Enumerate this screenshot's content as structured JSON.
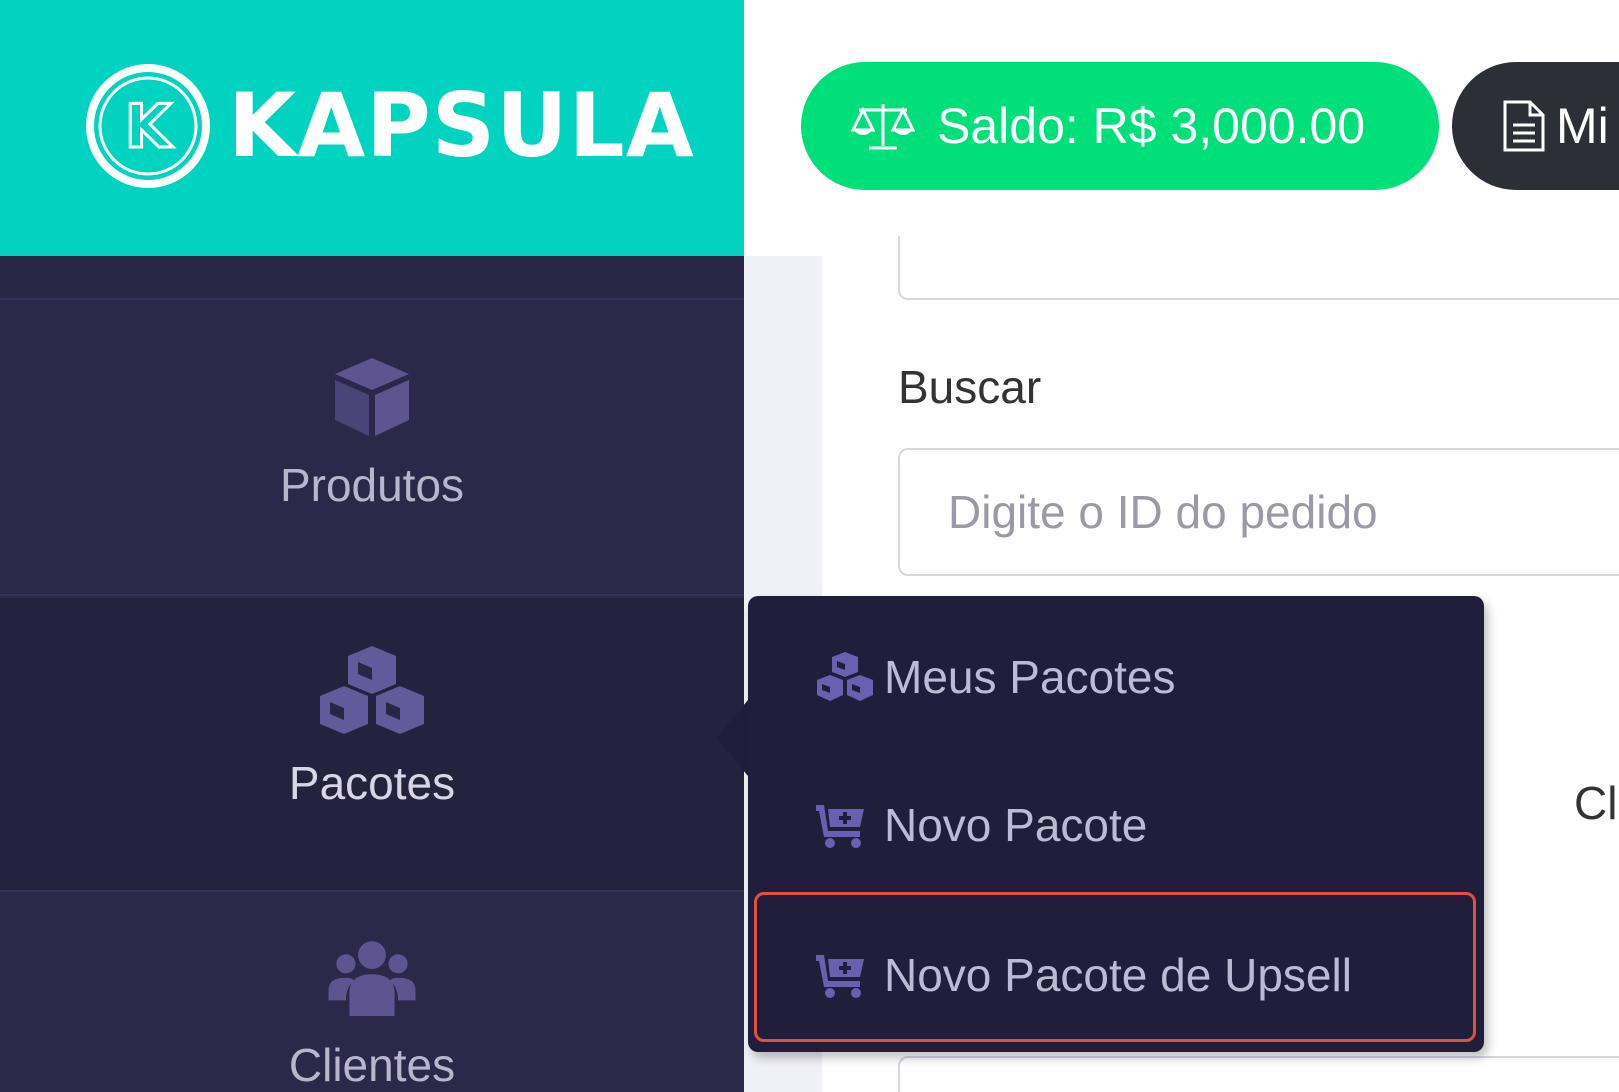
{
  "brand": {
    "name": "KAPSULA",
    "logo_letter": "K"
  },
  "header": {
    "saldo_label": "Saldo: R$ 3,000.00",
    "second_button_label": "Mi"
  },
  "sidebar": {
    "items": [
      {
        "label": "Produtos",
        "icon": "cube-icon"
      },
      {
        "label": "Pacotes",
        "icon": "cubes-icon"
      },
      {
        "label": "Clientes",
        "icon": "users-icon"
      }
    ]
  },
  "main": {
    "buscar_label": "Buscar",
    "search_placeholder": "Digite o ID do pedido",
    "partial_label": "Clien"
  },
  "flyout": {
    "items": [
      {
        "label": "Meus Pacotes",
        "icon": "cubes-icon"
      },
      {
        "label": "Novo Pacote",
        "icon": "cart-plus-icon"
      },
      {
        "label": "Novo Pacote de Upsell",
        "icon": "cart-plus-icon"
      }
    ]
  },
  "colors": {
    "brand_teal": "#00d4c0",
    "sidebar_bg": "#2c2849",
    "saldo_green": "#00e07a",
    "highlight_red": "#e0523f",
    "icon_purple": "#6a5fb0"
  }
}
